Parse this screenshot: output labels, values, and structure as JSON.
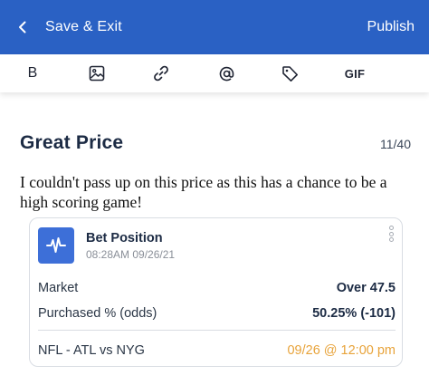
{
  "header": {
    "back_label": "Save & Exit",
    "publish_label": "Publish",
    "bg_color": "#2a61c4"
  },
  "toolbar": {
    "bold_label": "B",
    "gif_label": "GIF",
    "icons": [
      "image-icon",
      "link-icon",
      "mention-icon",
      "tag-icon"
    ]
  },
  "post": {
    "title": "Great Price",
    "counter": "11/40",
    "body": "I couldn't pass up on this price as this has a chance to be a high scoring game!"
  },
  "bet_card": {
    "title": "Bet Position",
    "timestamp": "08:28AM 09/26/21",
    "market_label": "Market",
    "market_value": "Over 47.5",
    "purchased_label": "Purchased % (odds)",
    "purchased_value": "50.25% (-101)",
    "game_label": "NFL - ATL vs NYG",
    "game_time": "09/26 @ 12:00 pm",
    "accent_color": "#e8a33a",
    "logo_color": "#3d6fd8"
  }
}
